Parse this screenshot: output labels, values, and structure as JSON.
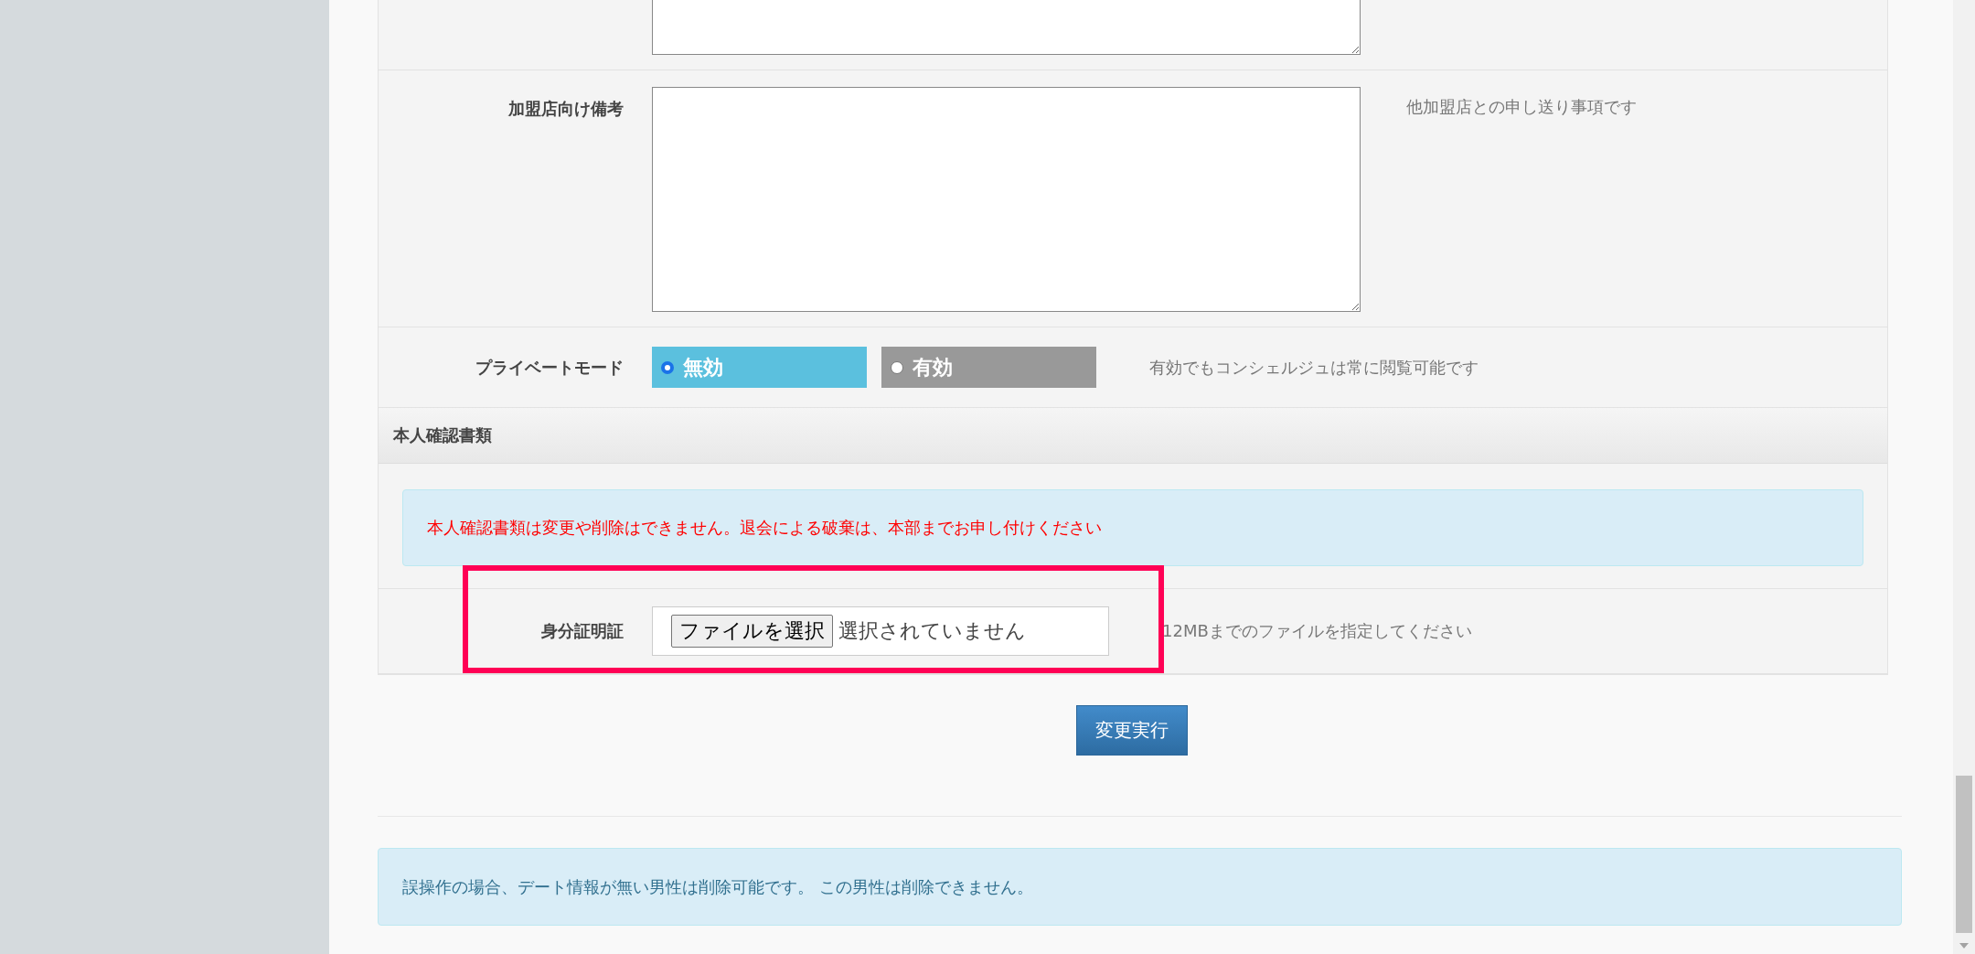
{
  "form_rows": [
    {
      "kind": "textarea"
    },
    {
      "kind": "textarea",
      "label": "加盟店向け備考",
      "hint": "他加盟店との申し送り事項です"
    },
    {
      "kind": "radio",
      "label": "プライベートモード",
      "hint": "有効でもコンシェルジュは常に閲覧可能です",
      "options": [
        {
          "label": "無効",
          "selected": true
        },
        {
          "label": "有効",
          "selected": false
        }
      ]
    }
  ],
  "section": {
    "title": "本人確認書類",
    "notice": "本人確認書類は変更や削除はできません。退会による破棄は、本部までお申し付けください",
    "file_row": {
      "label": "身分証明証",
      "button": "ファイルを選択",
      "status": "選択されていません",
      "hint": "12MBまでのファイルを指定してください"
    }
  },
  "submit_button": "変更実行",
  "footer_notice": "誤操作の場合、デート情報が無い男性は削除可能です。 この男性は削除できません。"
}
